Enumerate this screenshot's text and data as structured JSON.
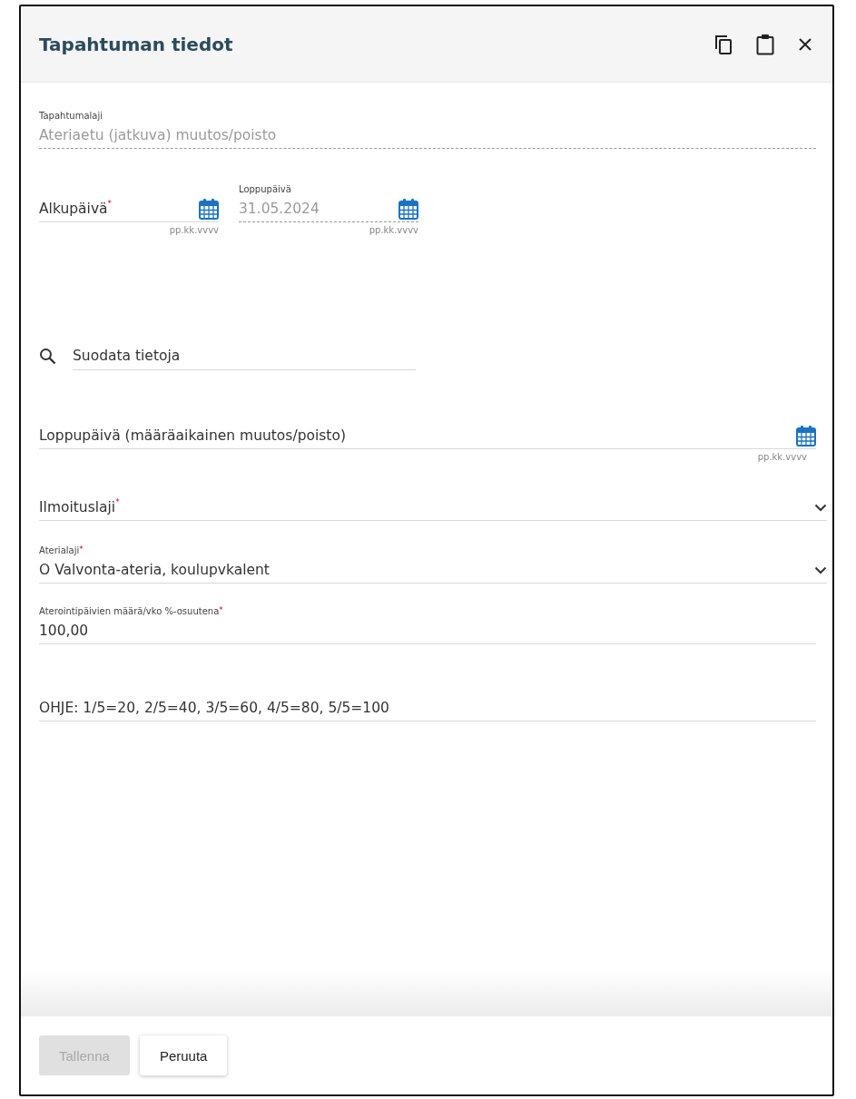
{
  "dialog": {
    "title": "Tapahtuman tiedot"
  },
  "event_type": {
    "label": "Tapahtumalaji",
    "value": "Ateriaetu (jatkuva) muutos/poisto",
    "readonly": true
  },
  "dates": [
    {
      "label": "Alkupäivä$^{*}$",
      "hint": "pp.kk.vvvv",
      "readonly": false
    },
    {
      "label": "Loppupäivä",
      "value": "31.05.2024",
      "hint": "pp.kk.vvvv",
      "readonly": true
    }
  ],
  "filter": {
    "placeholder": "Suodata tietoja"
  },
  "fields": [
    {
      "kind": "date",
      "label": "Loppupäivä (määräaikainen muutos/poisto)",
      "hint": "pp.kk.vvvv"
    },
    {
      "kind": "select",
      "label": "Ilmoituslaji$^{*}$"
    },
    {
      "kind": "select",
      "label": "Aterialaji$^{*}$",
      "value": "O Valvonta-ateria, koulupvkalent"
    },
    {
      "kind": "text",
      "label": "Aterointipäivien määrä/vko %-osuutena$^{*}$",
      "value": "100,00"
    },
    {
      "kind": "text",
      "value": "OHJE: 1/5=20, 2/5=40, 3/5=60, 4/5=80, 5/5=100"
    }
  ],
  "buttons": [
    {
      "label": "Tallenna",
      "disabled": true
    },
    {
      "label": "Peruuta",
      "disabled": false
    }
  ]
}
